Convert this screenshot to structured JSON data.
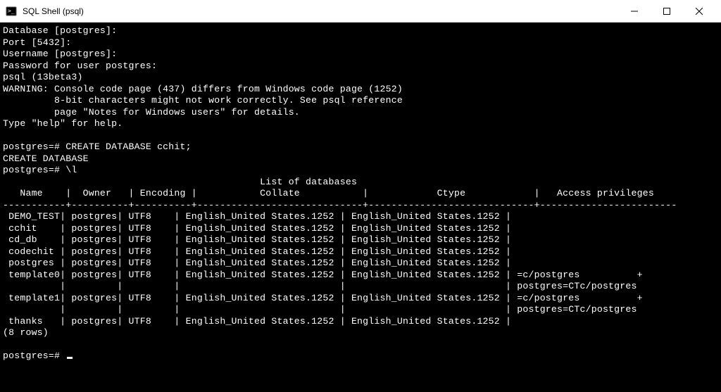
{
  "window": {
    "title": "SQL Shell (psql)",
    "icon": "terminal-icon"
  },
  "session": {
    "lines_before_table": [
      "Database [postgres]:",
      "Port [5432]:",
      "Username [postgres]:",
      "Password for user postgres:",
      "psql (13beta3)",
      "WARNING: Console code page (437) differs from Windows code page (1252)",
      "         8-bit characters might not work correctly. See psql reference",
      "         page \"Notes for Windows users\" for details.",
      "Type \"help\" for help.",
      "",
      "postgres=# CREATE DATABASE cchit;",
      "CREATE DATABASE",
      "postgres=# \\l"
    ],
    "table_title": "List of databases",
    "headers": [
      "Name",
      "Owner",
      "Encoding",
      "Collate",
      "Ctype",
      "Access privileges"
    ],
    "rows": [
      {
        "name": "DEMO_TEST",
        "owner": "postgres",
        "encoding": "UTF8",
        "collate": "English_United States.1252",
        "ctype": "English_United States.1252",
        "privileges": ""
      },
      {
        "name": "cchit",
        "owner": "postgres",
        "encoding": "UTF8",
        "collate": "English_United States.1252",
        "ctype": "English_United States.1252",
        "privileges": ""
      },
      {
        "name": "cd_db",
        "owner": "postgres",
        "encoding": "UTF8",
        "collate": "English_United States.1252",
        "ctype": "English_United States.1252",
        "privileges": ""
      },
      {
        "name": "codechit",
        "owner": "postgres",
        "encoding": "UTF8",
        "collate": "English_United States.1252",
        "ctype": "English_United States.1252",
        "privileges": ""
      },
      {
        "name": "postgres",
        "owner": "postgres",
        "encoding": "UTF8",
        "collate": "English_United States.1252",
        "ctype": "English_United States.1252",
        "privileges": ""
      },
      {
        "name": "template0",
        "owner": "postgres",
        "encoding": "UTF8",
        "collate": "English_United States.1252",
        "ctype": "English_United States.1252",
        "privileges": "=c/postgres          +\npostgres=CTc/postgres"
      },
      {
        "name": "template1",
        "owner": "postgres",
        "encoding": "UTF8",
        "collate": "English_United States.1252",
        "ctype": "English_United States.1252",
        "privileges": "=c/postgres          +\npostgres=CTc/postgres"
      },
      {
        "name": "thanks",
        "owner": "postgres",
        "encoding": "UTF8",
        "collate": "English_United States.1252",
        "ctype": "English_United States.1252",
        "privileges": ""
      }
    ],
    "row_count_text": "(8 rows)",
    "prompt": "postgres=# "
  },
  "widths": {
    "name": 10,
    "owner": 9,
    "encoding": 9,
    "collate": 28,
    "ctype": 28,
    "privileges": 22
  }
}
